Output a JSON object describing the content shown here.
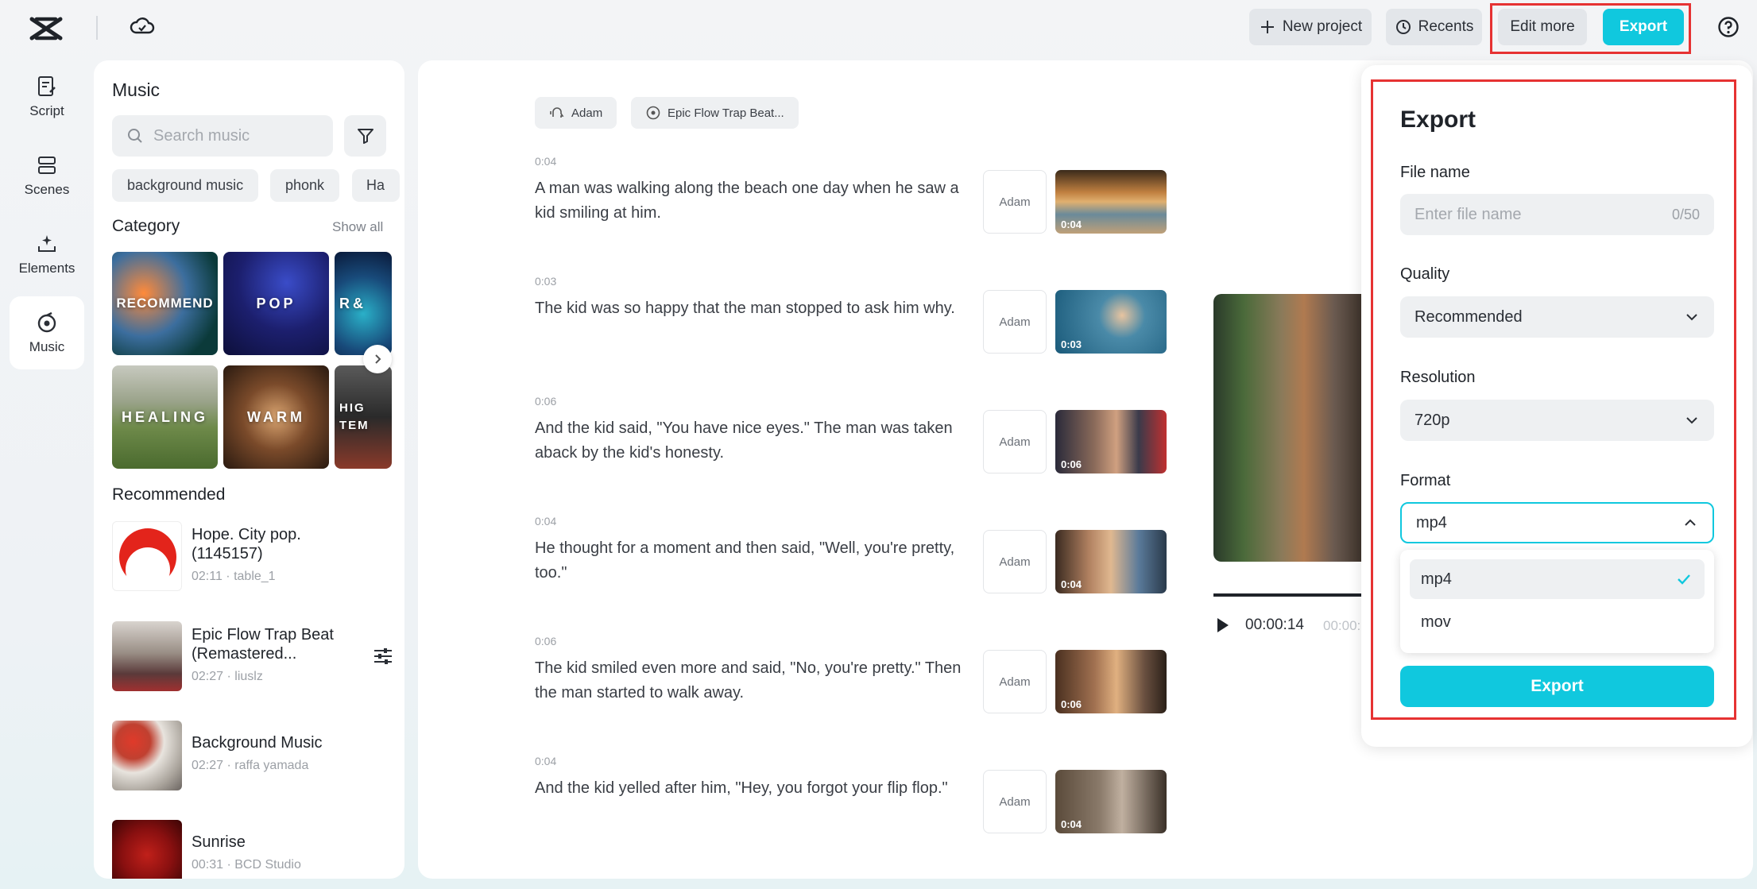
{
  "header": {
    "new_project": "New project",
    "recents": "Recents",
    "edit_more": "Edit more",
    "export": "Export",
    "accent": "#10c8de"
  },
  "rail": [
    {
      "label": "Script",
      "icon": "script-icon"
    },
    {
      "label": "Scenes",
      "icon": "scenes-icon"
    },
    {
      "label": "Elements",
      "icon": "elements-icon"
    },
    {
      "label": "Music",
      "icon": "music-icon",
      "active": true
    }
  ],
  "music": {
    "title": "Music",
    "search_placeholder": "Search music",
    "chips": [
      "background music",
      "phonk",
      "Ha"
    ],
    "category_title": "Category",
    "show_all": "Show all",
    "categories": [
      "RECOMMEND",
      "POP",
      "R&",
      "HEALING",
      "WARM",
      "HIG TEM"
    ],
    "recommended_title": "Recommended",
    "tracks": [
      {
        "name": "Hope. City pop. (1145157)",
        "meta": "02:11 · table_1"
      },
      {
        "name": "Epic Flow Trap Beat (Remastered...",
        "meta": "02:27 · liuslz"
      },
      {
        "name": "Background Music",
        "meta": "02:27 · raffa yamada"
      },
      {
        "name": "Sunrise",
        "meta": "00:31 · BCD Studio"
      }
    ]
  },
  "script": {
    "voice_tag": "Adam",
    "music_tag": "Epic Flow Trap Beat...",
    "scenes": [
      {
        "time": "0:04",
        "text": "A man was walking along the beach one day when he saw a kid smiling at him.",
        "voice": "Adam",
        "dur": "0:04"
      },
      {
        "time": "0:03",
        "text": "The kid was so happy that the man stopped to ask him why.",
        "voice": "Adam",
        "dur": "0:03"
      },
      {
        "time": "0:06",
        "text": "And the kid said, \"You have nice eyes.\" The man was taken aback by the kid's honesty.",
        "voice": "Adam",
        "dur": "0:06"
      },
      {
        "time": "0:04",
        "text": "He thought for a moment and then said, \"Well, you're pretty, too.\"",
        "voice": "Adam",
        "dur": "0:04"
      },
      {
        "time": "0:06",
        "text": "The kid smiled even more and said, \"No, you're pretty.\" Then the man started to walk away.",
        "voice": "Adam",
        "dur": "0:06"
      },
      {
        "time": "0:04",
        "text": "And the kid yelled after him, \"Hey, you forgot your flip flop.\"",
        "voice": "Adam",
        "dur": "0:04"
      }
    ],
    "player": {
      "current": "00:00:14",
      "total": "00:00:"
    }
  },
  "export_panel": {
    "title": "Export",
    "file_name_label": "File name",
    "file_name_placeholder": "Enter file name",
    "file_name_count": "0/50",
    "quality_label": "Quality",
    "quality_value": "Recommended",
    "resolution_label": "Resolution",
    "resolution_value": "720p",
    "format_label": "Format",
    "format_value": "mp4",
    "format_options": [
      "mp4",
      "mov"
    ],
    "export_button": "Export"
  }
}
